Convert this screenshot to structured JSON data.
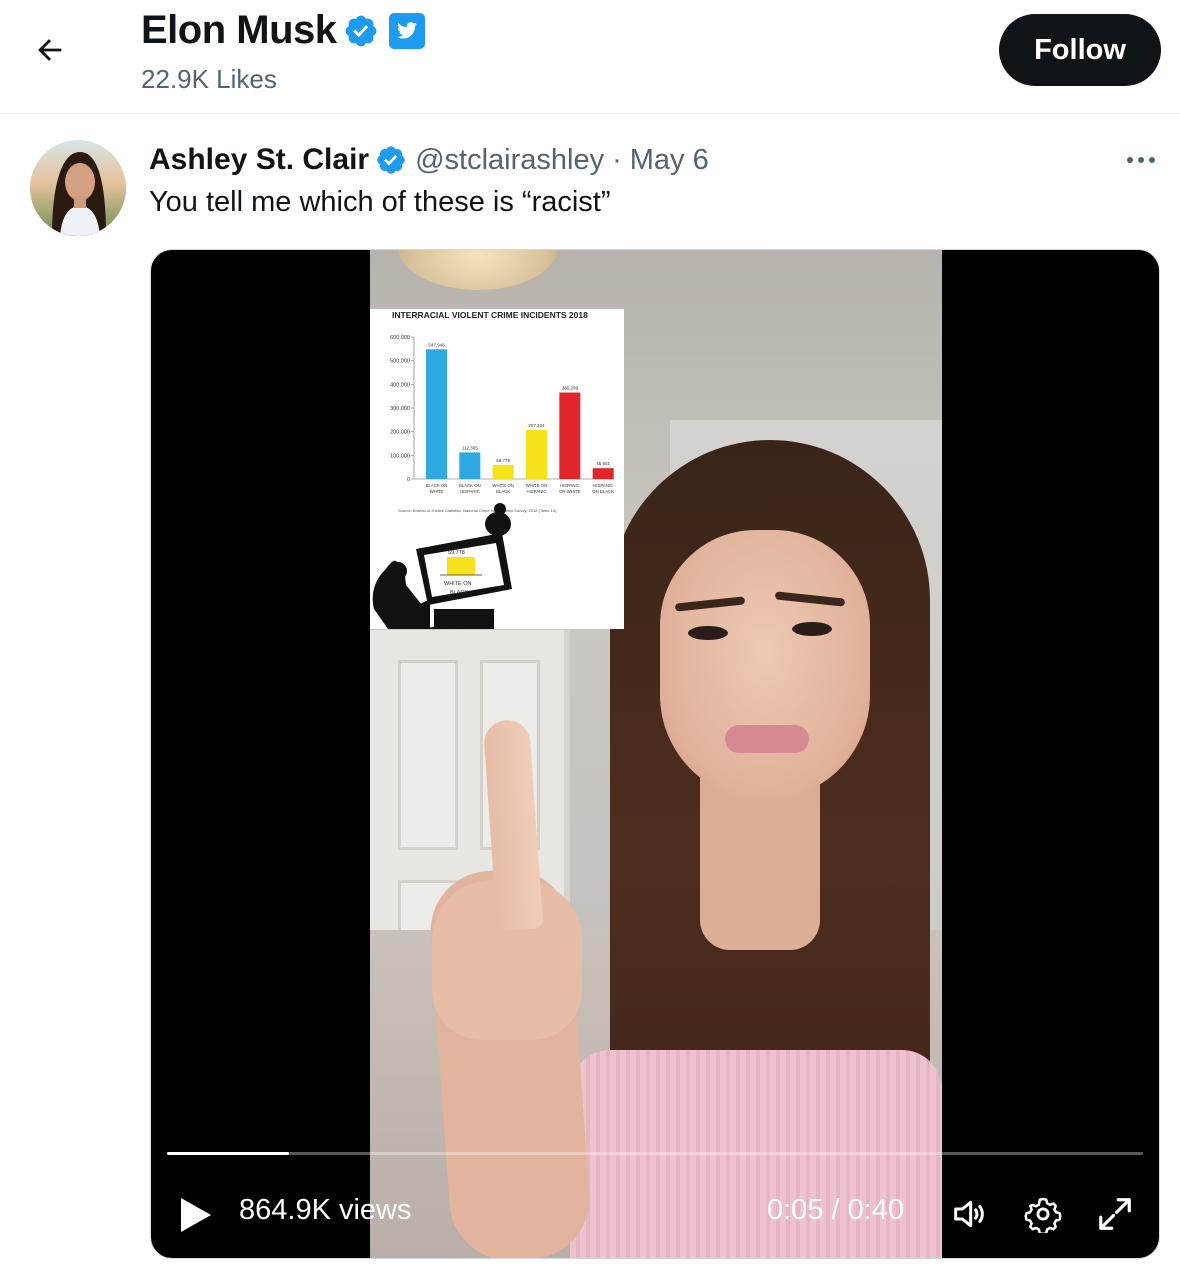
{
  "header": {
    "back_icon": "arrow-left-icon",
    "name": "Elon Musk",
    "verified_icon": "verified-badge-icon",
    "bird_icon": "twitter-bird-icon",
    "subtitle": "22.9K Likes",
    "follow_label": "Follow"
  },
  "tweet": {
    "author_name": "Ashley St. Clair",
    "verified_icon": "verified-badge-icon",
    "handle": "@stclairashley",
    "separator": "·",
    "date": "May 6",
    "more_icon": "more-horizontal-icon",
    "text": "You tell me which of these is “racist”"
  },
  "video": {
    "views": "864.9K views",
    "time": "0:05 / 0:40",
    "progress": 0.125,
    "play_icon": "play-icon",
    "volume_icon": "volume-icon",
    "settings_icon": "gear-icon",
    "fullscreen_icon": "fullscreen-icon"
  },
  "chart_data": {
    "type": "bar",
    "title": "INTERRACIAL VIOLENT CRIME INCIDENTS 2018",
    "categories": [
      [
        "BLACK ON",
        "WHITE"
      ],
      [
        "BLACK ON",
        "HISPANIC"
      ],
      [
        "WHITE ON",
        "BLACK"
      ],
      [
        "WHITE ON",
        "HISPANIC"
      ],
      [
        "HISPANIC",
        "ON WHITE"
      ],
      [
        "HISPANIC",
        "ON BLACK"
      ]
    ],
    "values": [
      547948,
      112365,
      59778,
      207104,
      365299,
      45651
    ],
    "value_labels": [
      "547,948",
      "112,365",
      "59,778",
      "207,104",
      "365,299",
      "45,651"
    ],
    "colors": [
      "#2ea8e0",
      "#2ea8e0",
      "#f5e21b",
      "#f5e21b",
      "#e0262b",
      "#e0262b"
    ],
    "ylim": [
      0,
      600000
    ],
    "yticks": [
      "0",
      "100,000",
      "200,000",
      "300,000",
      "400,000",
      "500,000",
      "600,000"
    ],
    "source": "Source: Bureau of Justice Statistics, National Crime Victimization Survey, 2018 (Table 14)",
    "cartoon_value": "59,778",
    "cartoon_label": [
      "WHITE ON",
      "BLACK"
    ]
  }
}
